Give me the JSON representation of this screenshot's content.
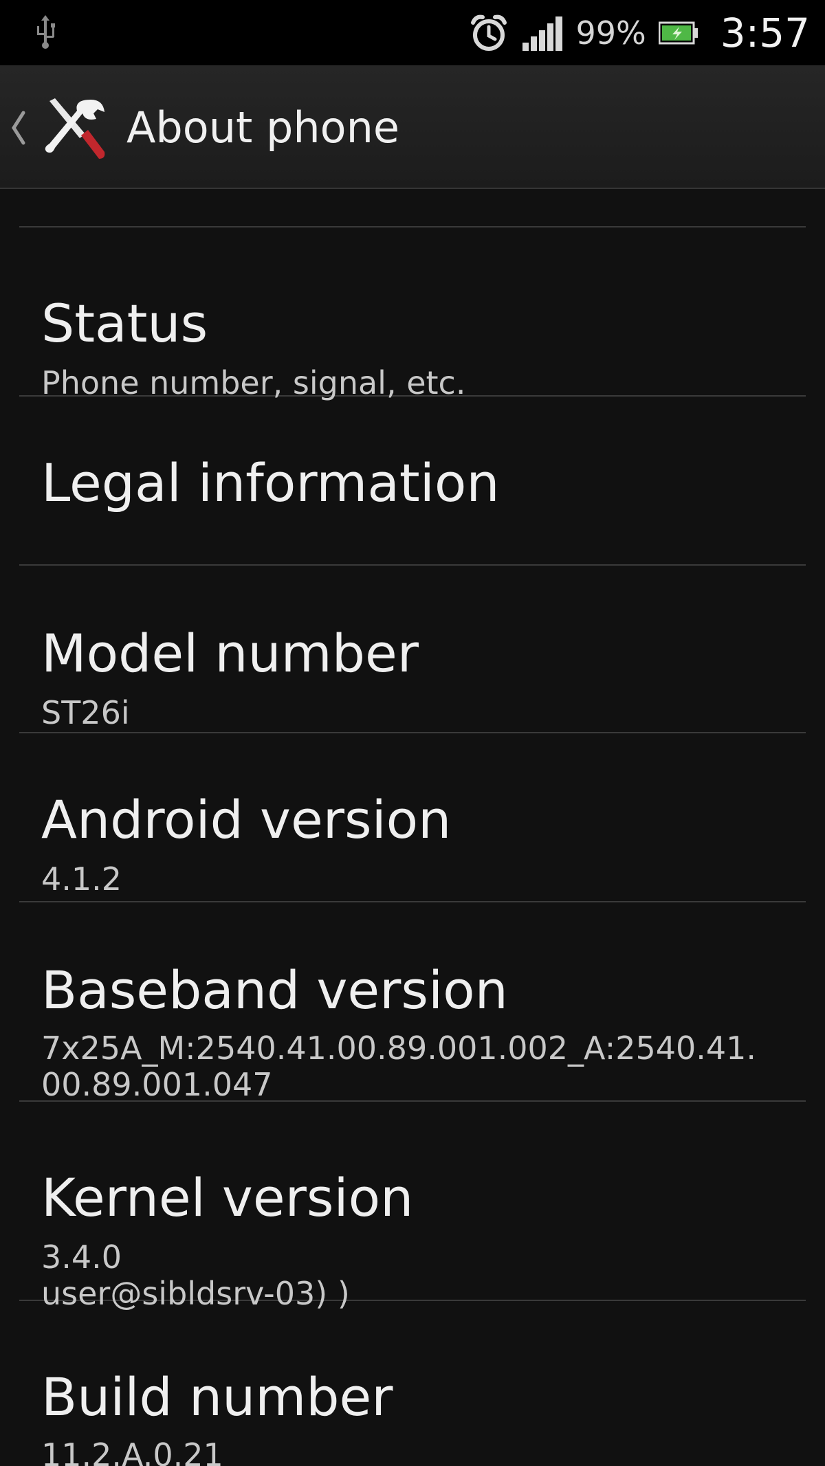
{
  "status_bar": {
    "battery_percent": "99%",
    "time": "3:57",
    "icons": [
      "usb-icon",
      "alarm-icon",
      "signal-icon",
      "battery-icon"
    ]
  },
  "action_bar": {
    "title": "About phone",
    "icons": [
      "back-icon",
      "tools-icon"
    ]
  },
  "items": {
    "status": {
      "title": "Status",
      "subtitle": "Phone number, signal, etc."
    },
    "legal": {
      "title": "Legal information"
    },
    "model": {
      "title": "Model number",
      "value": "ST26i"
    },
    "android": {
      "title": "Android version",
      "value": "4.1.2"
    },
    "baseband": {
      "title": "Baseband version",
      "value_line1": "7x25A_M:2540.41.00.89.001.002_A:2540.41.",
      "value_line2": "00.89.001.047"
    },
    "kernel": {
      "title": "Kernel version",
      "value_line1": "3.4.0",
      "value_line2": "user@sibldsrv-03) )"
    },
    "build": {
      "title": "Build number",
      "value": "11.2.A.0.21"
    }
  },
  "colors": {
    "status_bar_bg": "#000000",
    "background": "#111111",
    "divider": "#3a3a3a",
    "text_primary": "#efefef",
    "text_secondary": "#c8c8c8",
    "tools_icon_red": "#c1272d"
  }
}
